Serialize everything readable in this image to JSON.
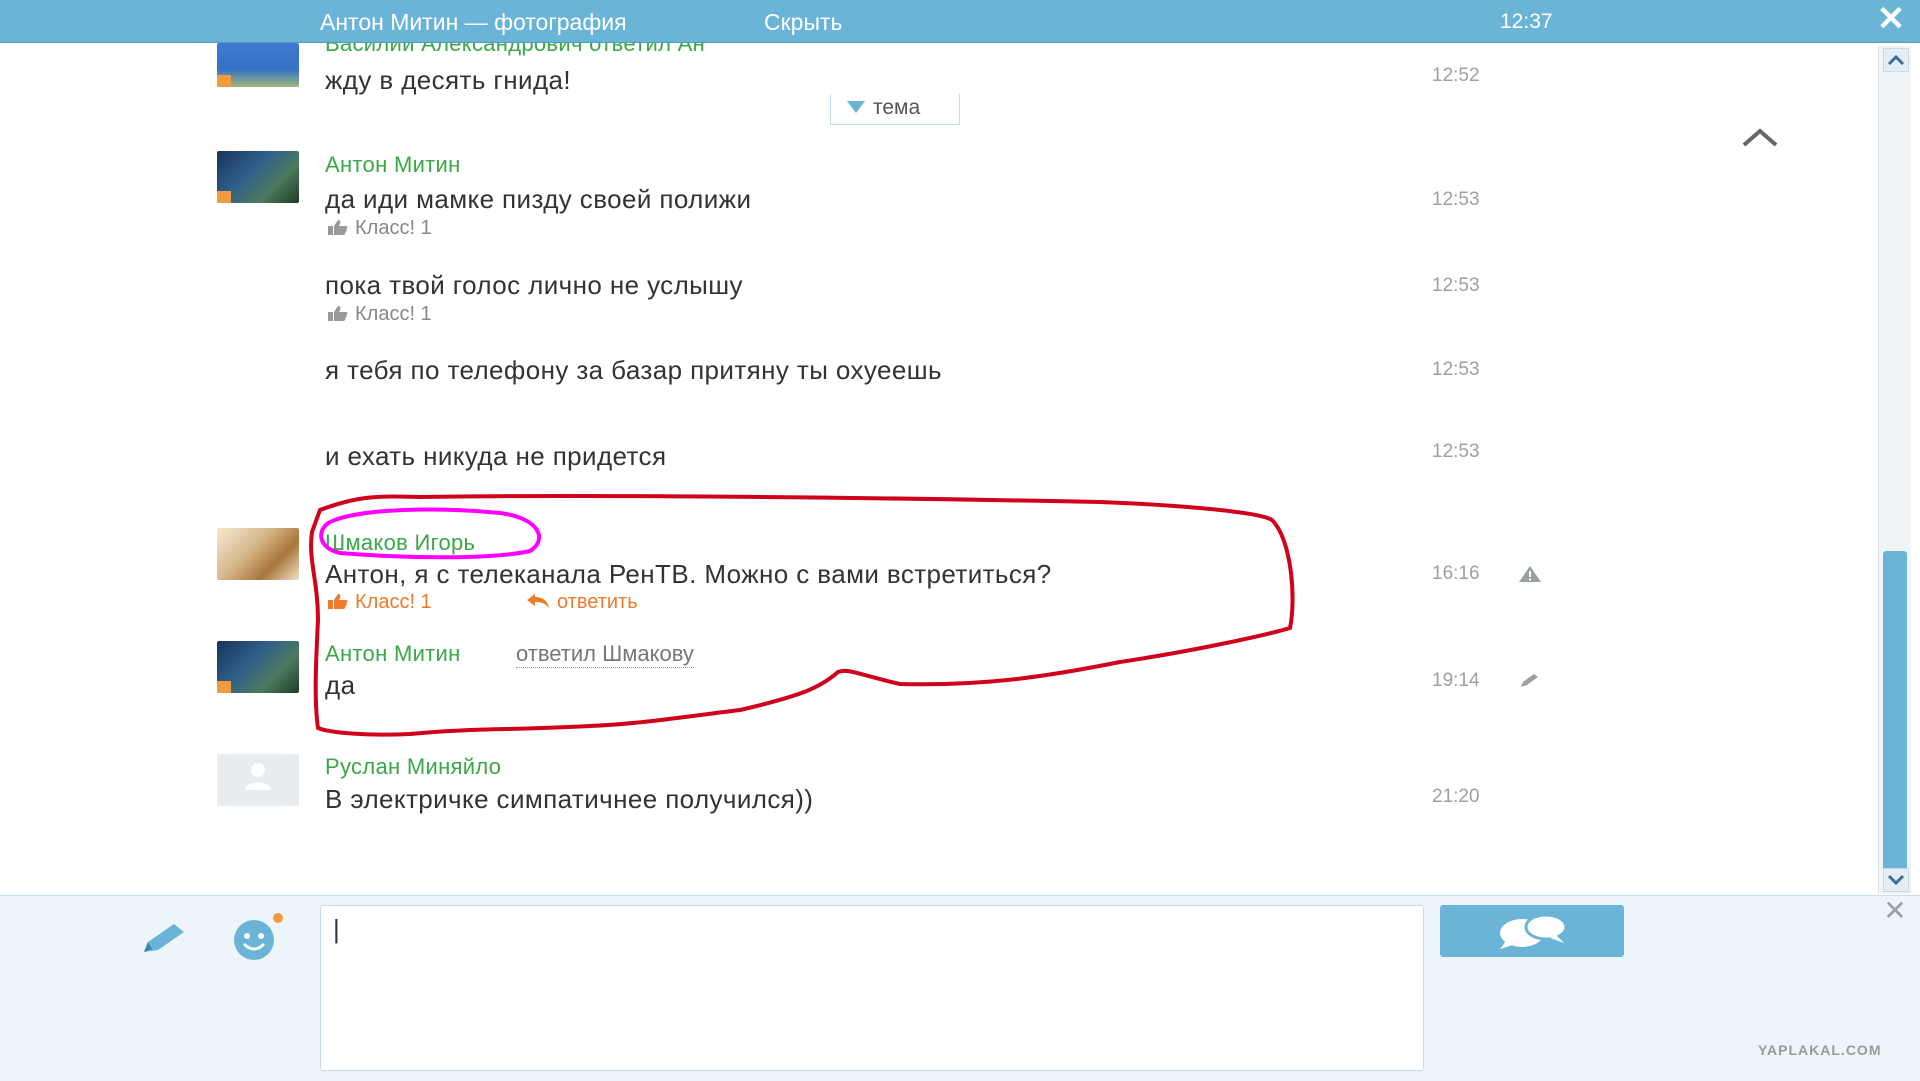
{
  "window": {
    "title": "Антон Митин — фотография",
    "hide_label": "Скрыть",
    "clock": "12:37"
  },
  "topic": {
    "label": "тема"
  },
  "messages": [
    {
      "author": "Василий Александрович ответил Ан",
      "text": "жду в десять гнида!",
      "time": "12:52"
    },
    {
      "author": "Антон Митин",
      "text": "да иди мамке пизду своей полижи",
      "time": "12:53",
      "klass": "Класс! 1"
    },
    {
      "text": "пока твой голос лично не услышу",
      "time": "12:53",
      "klass": "Класс! 1"
    },
    {
      "text": "я тебя по телефону за базар притяну ты охуеешь",
      "time": "12:53"
    },
    {
      "text": "и ехать никуда не придется",
      "time": "12:53"
    },
    {
      "author": "Шмаков Игорь",
      "text": "Антон, я с телеканала РенТВ. Можно с вами встретиться?",
      "time": "16:16",
      "klass": "Класс! 1",
      "reply": "ответить"
    },
    {
      "author": "Антон Митин",
      "replied_to": "ответил Шмакову",
      "text": "да",
      "time": "19:14"
    },
    {
      "author": "Руслан Миняйло",
      "text": "В электричке симпатичнее получился))",
      "time": "21:20"
    }
  ],
  "composer": {
    "value": "|"
  },
  "watermark": "YAPLAKAL.COM",
  "colors": {
    "bar": "#6ab4d7",
    "author": "#3aa845",
    "accent": "#ee7a2b",
    "annotation_red": "#d0021b",
    "annotation_magenta": "#ff00ff"
  }
}
